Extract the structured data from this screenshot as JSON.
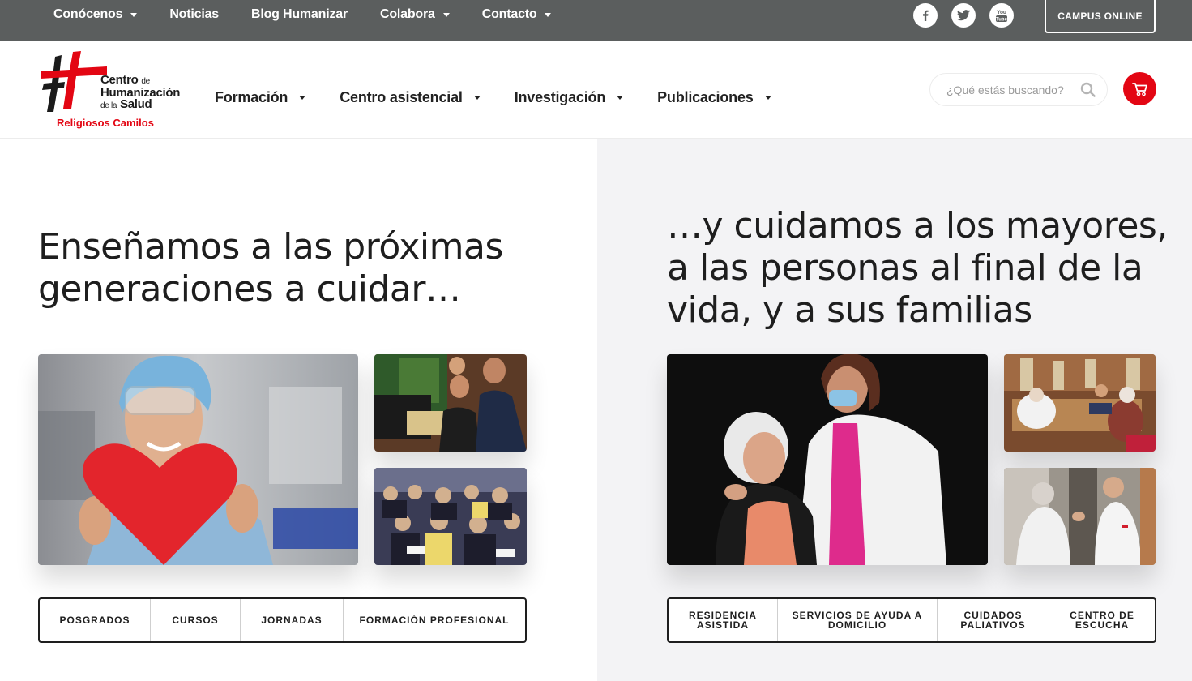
{
  "topbar": {
    "nav": [
      {
        "label": "Conócenos",
        "dropdown": true
      },
      {
        "label": "Noticias",
        "dropdown": false
      },
      {
        "label": "Blog Humanizar",
        "dropdown": false
      },
      {
        "label": "Colabora",
        "dropdown": true
      },
      {
        "label": "Contacto",
        "dropdown": true
      }
    ],
    "social": [
      "facebook-icon",
      "twitter-icon",
      "youtube-icon"
    ],
    "youtube_text": "You Tube",
    "campus_label": "CAMPUS ONLINE"
  },
  "logo": {
    "line1": "Centro",
    "line1_small": "de",
    "line2": "Humanización",
    "line3_small": "de la",
    "line3": "Salud",
    "tagline": "Religiosos Camilos"
  },
  "mainnav": [
    {
      "label": "Formación"
    },
    {
      "label": "Centro asistencial"
    },
    {
      "label": "Investigación"
    },
    {
      "label": "Publicaciones"
    }
  ],
  "search": {
    "placeholder": "¿Qué estás buscando?"
  },
  "left": {
    "headline_l1": "Enseñamos a las próximas",
    "headline_l2": "generaciones a cuidar…",
    "buttons": [
      "POSGRADOS",
      "CURSOS",
      "JORNADAS",
      "FORMACIÓN PROFESIONAL"
    ]
  },
  "right": {
    "headline_l1": "…y cuidamos a los mayores,",
    "headline_l2": "a las personas al final de la",
    "headline_l3": "vida, y a sus familias",
    "buttons": [
      {
        "l1": "RESIDENCIA",
        "l2": "ASISTIDA"
      },
      {
        "l1": "SERVICIOS DE AYUDA A",
        "l2": "DOMICILIO"
      },
      {
        "l1": "CUIDADOS",
        "l2": "PALIATIVOS"
      },
      {
        "l1": "CENTRO DE",
        "l2": "ESCUCHA"
      }
    ]
  },
  "colors": {
    "topbar": "#5b5e5e",
    "brand_red": "#e30613",
    "right_panel": "#f3f3f5"
  }
}
